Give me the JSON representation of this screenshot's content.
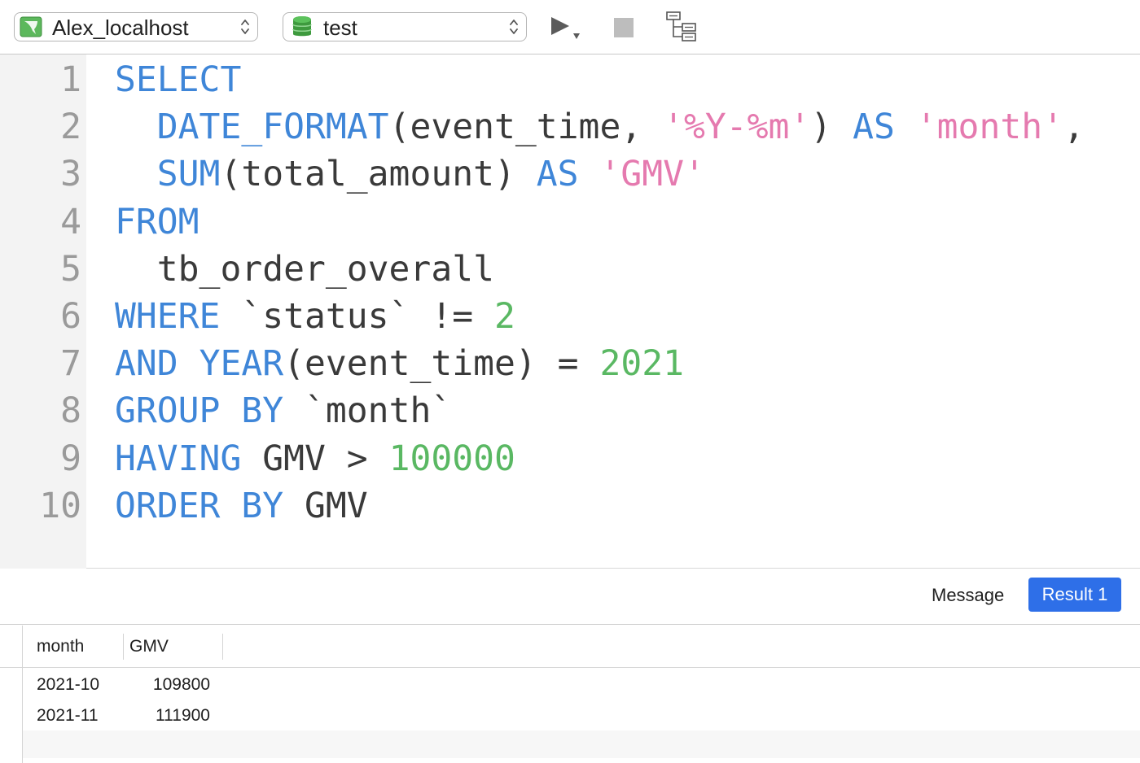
{
  "toolbar": {
    "connection": {
      "label": "Alex_localhost",
      "icon": "mysql-connection-icon"
    },
    "database": {
      "label": "test",
      "icon": "database-icon"
    },
    "run_icon": "play-icon",
    "stop_icon": "stop-icon",
    "explain_icon": "explain-tree-icon"
  },
  "editor": {
    "lines": [
      {
        "number": "1",
        "tokens": [
          {
            "t": "SELECT",
            "c": "kw"
          }
        ]
      },
      {
        "number": "2",
        "tokens": [
          {
            "t": "  ",
            "c": "id"
          },
          {
            "t": "DATE_FORMAT",
            "c": "fn"
          },
          {
            "t": "(event_time, ",
            "c": "id"
          },
          {
            "t": "'%Y-%m'",
            "c": "str"
          },
          {
            "t": ") ",
            "c": "id"
          },
          {
            "t": "AS",
            "c": "kw"
          },
          {
            "t": " ",
            "c": "id"
          },
          {
            "t": "'month'",
            "c": "str"
          },
          {
            "t": ",",
            "c": "id"
          }
        ]
      },
      {
        "number": "3",
        "tokens": [
          {
            "t": "  ",
            "c": "id"
          },
          {
            "t": "SUM",
            "c": "fn"
          },
          {
            "t": "(total_amount) ",
            "c": "id"
          },
          {
            "t": "AS",
            "c": "kw"
          },
          {
            "t": " ",
            "c": "id"
          },
          {
            "t": "'GMV'",
            "c": "str"
          }
        ]
      },
      {
        "number": "4",
        "tokens": [
          {
            "t": "FROM",
            "c": "kw"
          }
        ]
      },
      {
        "number": "5",
        "tokens": [
          {
            "t": "  tb_order_overall",
            "c": "id"
          }
        ]
      },
      {
        "number": "6",
        "tokens": [
          {
            "t": "WHERE",
            "c": "kw"
          },
          {
            "t": " `status` != ",
            "c": "id"
          },
          {
            "t": "2",
            "c": "num"
          }
        ]
      },
      {
        "number": "7",
        "tokens": [
          {
            "t": "AND",
            "c": "kw"
          },
          {
            "t": " ",
            "c": "id"
          },
          {
            "t": "YEAR",
            "c": "fn"
          },
          {
            "t": "(event_time) = ",
            "c": "id"
          },
          {
            "t": "2021",
            "c": "num"
          }
        ]
      },
      {
        "number": "8",
        "tokens": [
          {
            "t": "GROUP",
            "c": "kw"
          },
          {
            "t": " ",
            "c": "id"
          },
          {
            "t": "BY",
            "c": "kw"
          },
          {
            "t": " `month`",
            "c": "id"
          }
        ]
      },
      {
        "number": "9",
        "tokens": [
          {
            "t": "HAVING",
            "c": "kw"
          },
          {
            "t": " GMV > ",
            "c": "id"
          },
          {
            "t": "100000",
            "c": "num"
          }
        ]
      },
      {
        "number": "10",
        "tokens": [
          {
            "t": "ORDER",
            "c": "kw"
          },
          {
            "t": " ",
            "c": "id"
          },
          {
            "t": "BY",
            "c": "kw"
          },
          {
            "t": " GMV",
            "c": "id"
          }
        ]
      }
    ]
  },
  "tabs": {
    "message_label": "Message",
    "result_label": "Result 1"
  },
  "grid": {
    "columns": [
      "month",
      "GMV"
    ],
    "rows": [
      [
        "2021-10",
        "109800"
      ],
      [
        "2021-11",
        "111900"
      ]
    ]
  },
  "colors": {
    "keyword": "#3f86d8",
    "string": "#e57aaf",
    "number": "#5ab863",
    "identifier": "#3a3a3a",
    "accent": "#2e6fe8"
  }
}
